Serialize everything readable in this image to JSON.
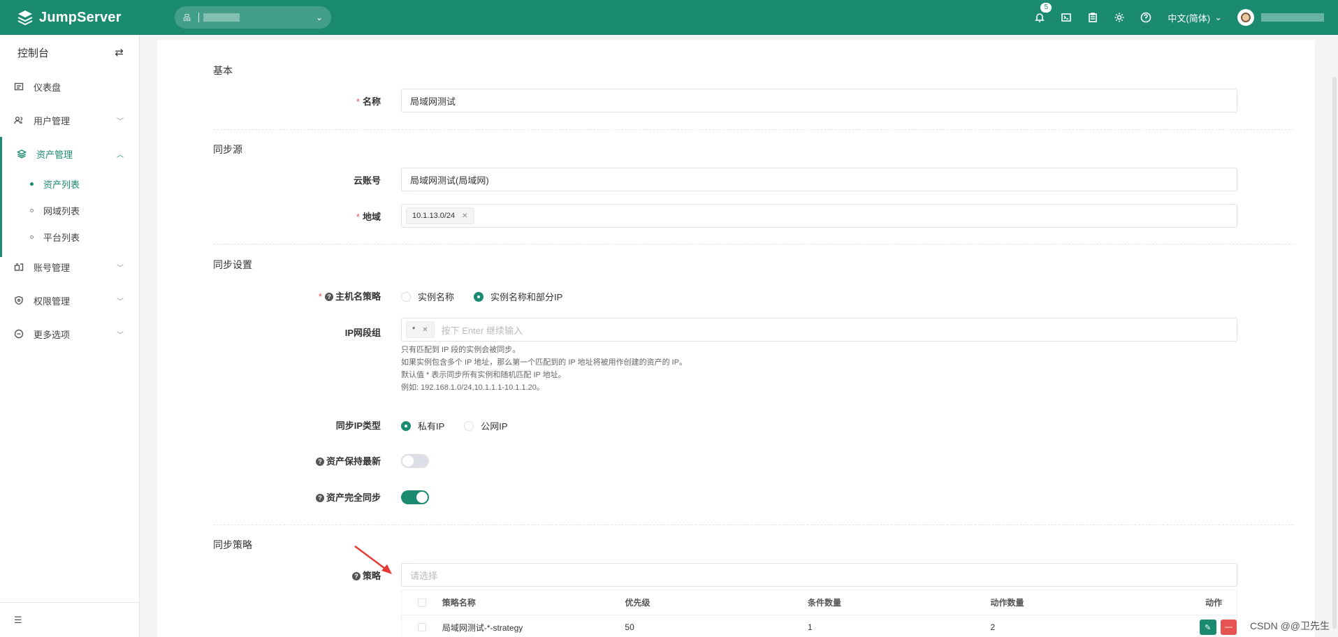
{
  "header": {
    "logo_text": "JumpServer",
    "notification_count": "5",
    "language": "中文(简体)"
  },
  "sidebar": {
    "title": "控制台",
    "items": [
      {
        "label": "仪表盘"
      },
      {
        "label": "用户管理"
      },
      {
        "label": "资产管理"
      },
      {
        "label": "账号管理"
      },
      {
        "label": "权限管理"
      },
      {
        "label": "更多选项"
      }
    ],
    "sub_items": [
      {
        "label": "资产列表"
      },
      {
        "label": "网域列表"
      },
      {
        "label": "平台列表"
      }
    ]
  },
  "form": {
    "section_basic": "基本",
    "name_label": "名称",
    "name_value": "局域网测试",
    "section_source": "同步源",
    "cloud_account_label": "云账号",
    "cloud_account_value": "局域网测试(局域网)",
    "region_label": "地域",
    "region_tag": "10.1.13.0/24",
    "section_settings": "同步设置",
    "hostname_label": "主机名策略",
    "hostname_opt1": "实例名称",
    "hostname_opt2": "实例名称和部分IP",
    "ip_group_label": "IP网段组",
    "ip_group_tag": "*",
    "ip_group_placeholder": "按下 Enter 继续输入",
    "ip_help_1": "只有匹配到 IP 段的实例会被同步。",
    "ip_help_2": "如果实例包含多个 IP 地址，那么第一个匹配到的 IP 地址将被用作创建的资产的 IP。",
    "ip_help_3": "默认值 * 表示同步所有实例和随机匹配 IP 地址。",
    "ip_help_4": "例如: 192.168.1.0/24,10.1.1.1-10.1.1.20。",
    "ip_type_label": "同步IP类型",
    "ip_type_opt1": "私有IP",
    "ip_type_opt2": "公网IP",
    "keep_latest_label": "资产保持最新",
    "full_sync_label": "资产完全同步",
    "section_strategy": "同步策略",
    "strategy_label": "策略",
    "strategy_placeholder": "请选择"
  },
  "table": {
    "headers": [
      "策略名称",
      "优先级",
      "条件数量",
      "动作数量",
      "动作"
    ],
    "rows": [
      {
        "name": "局域网测试-*-strategy",
        "priority": "50",
        "conditions": "1",
        "actions": "2"
      }
    ]
  },
  "watermark": "CSDN @@卫先生"
}
